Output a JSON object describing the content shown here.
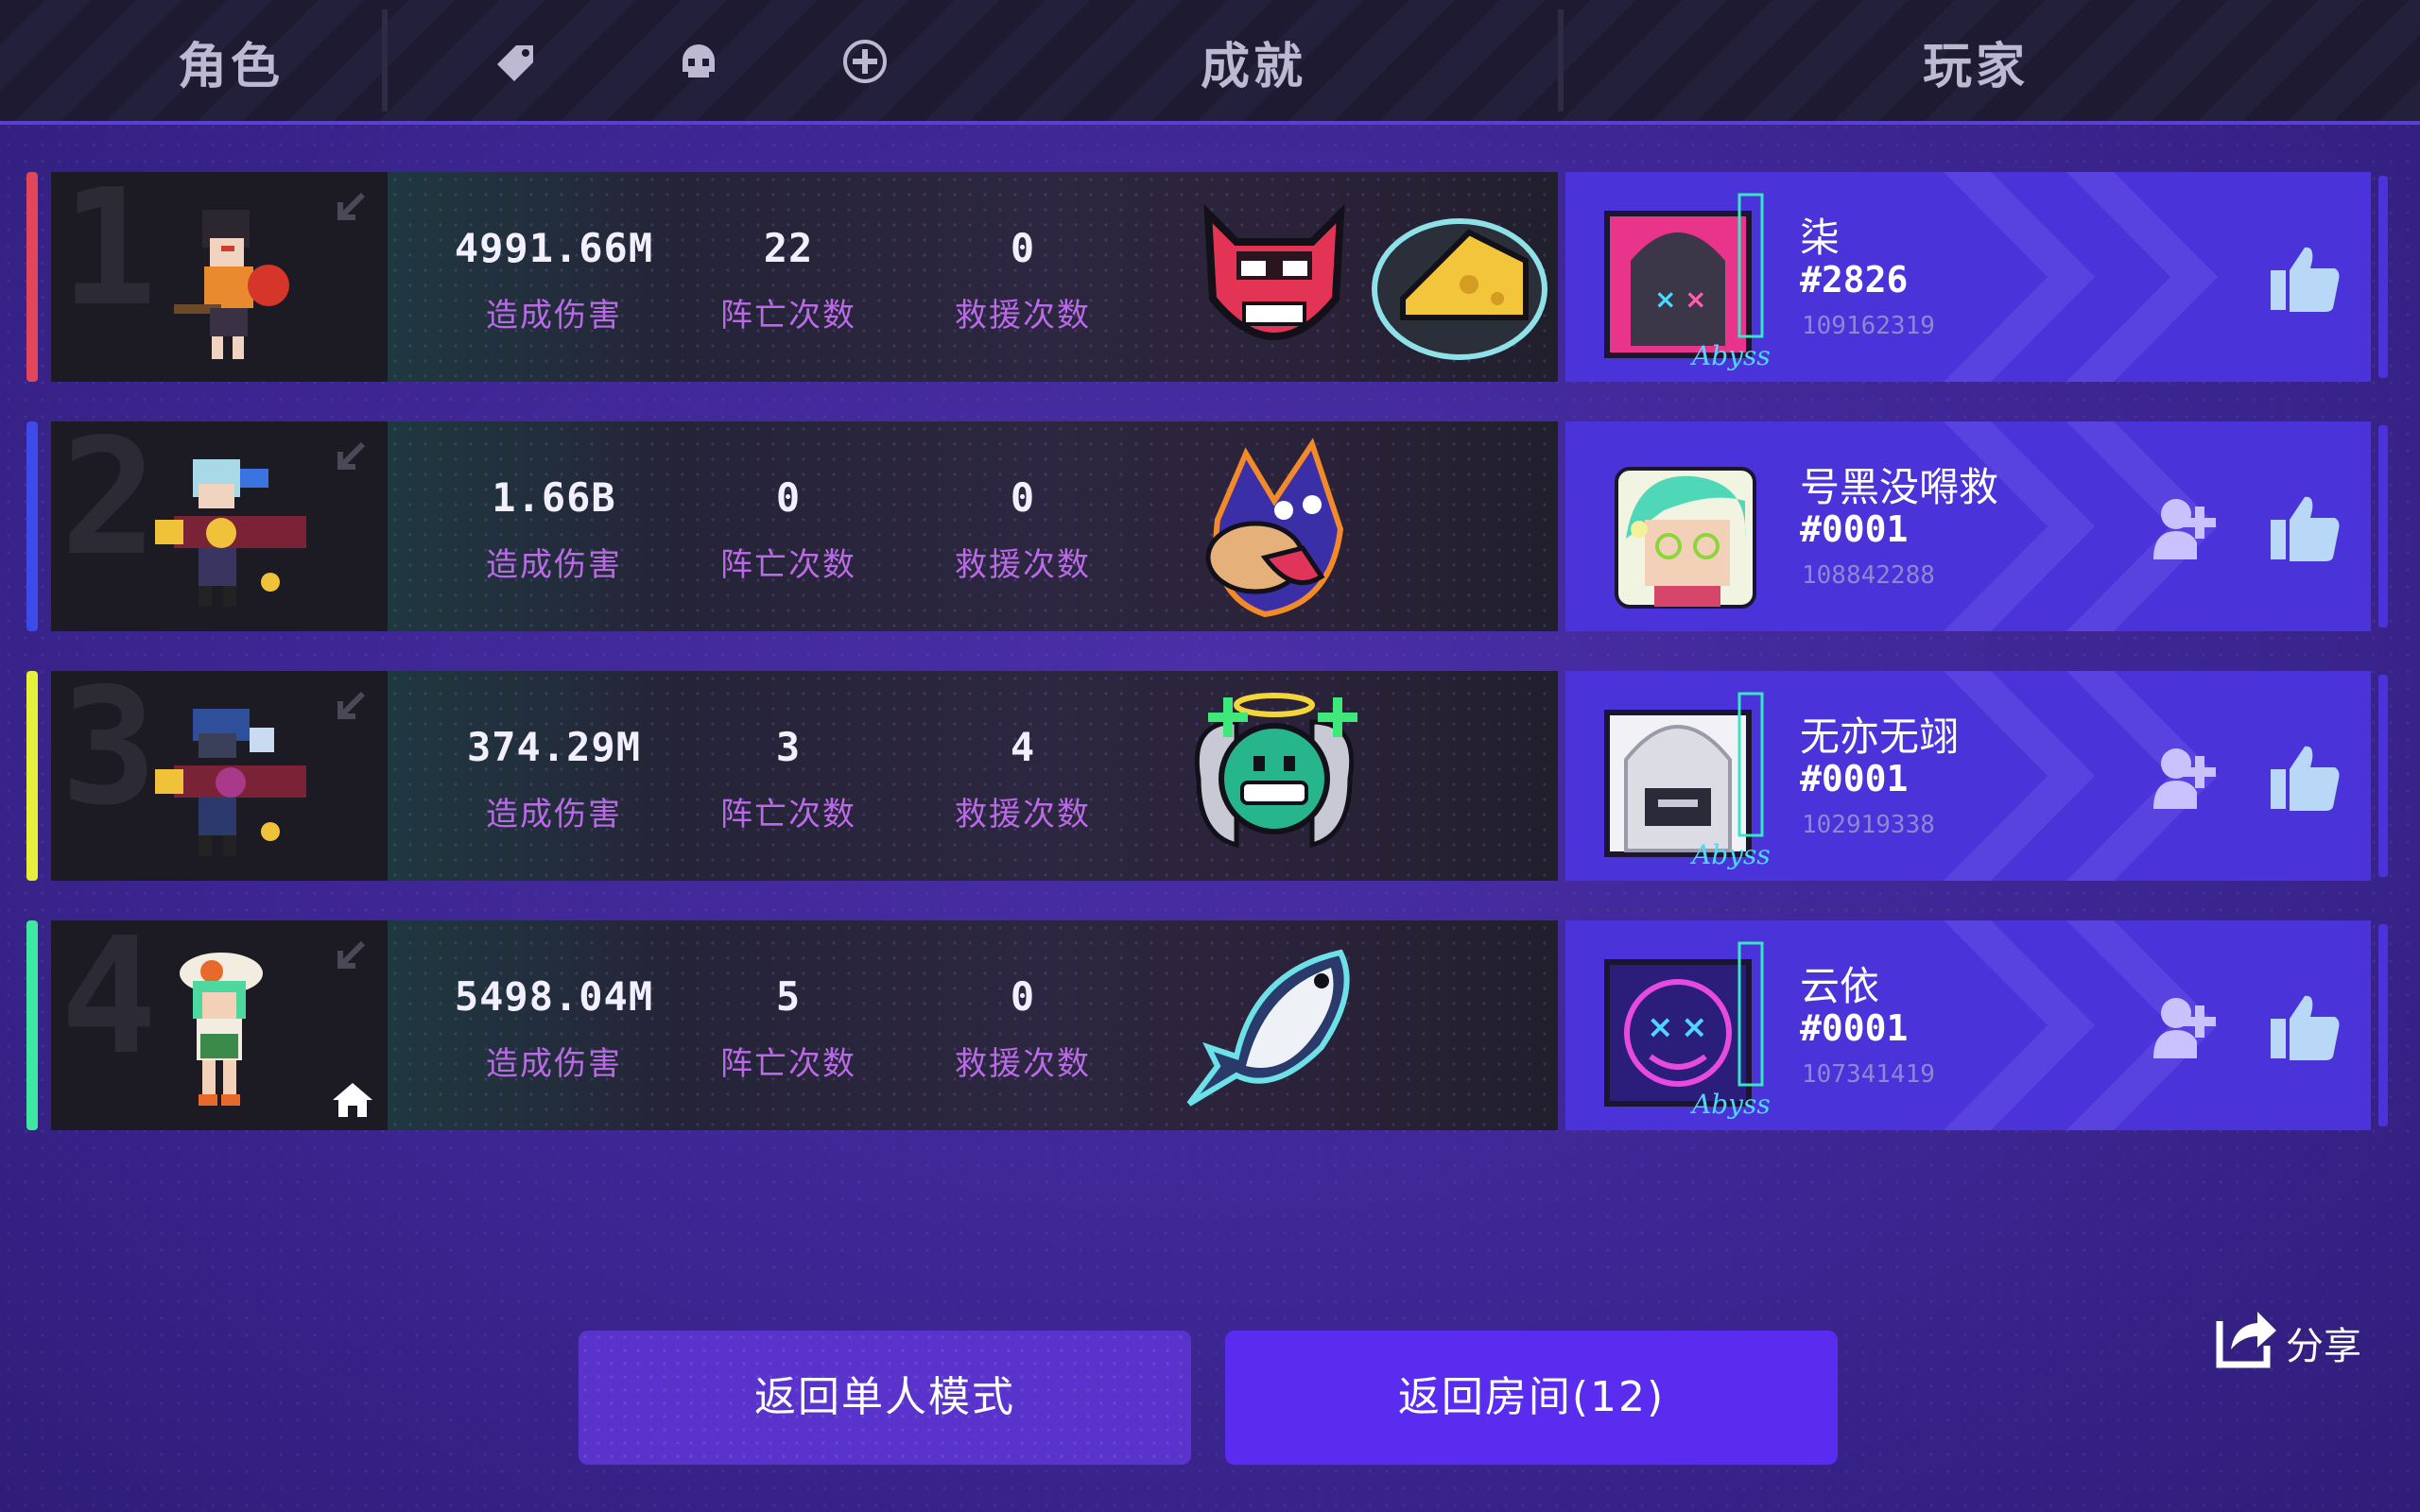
{
  "header": {
    "role_label": "角色",
    "achievement_label": "成就",
    "player_label": "玩家",
    "icons": [
      "tag-icon",
      "skull-icon",
      "heal-icon"
    ]
  },
  "rows": [
    {
      "rank": "1",
      "accent": "#e2465a",
      "damage_value": "4991.66M",
      "damage_label": "造成伤害",
      "deaths_value": "22",
      "deaths_label": "阵亡次数",
      "rescues_value": "0",
      "rescues_label": "救援次数",
      "badges": [
        "devil-mask-badge",
        "cheese-badge"
      ],
      "player": {
        "name": "柒",
        "tag": "#2826",
        "id": "109162319",
        "avatar": "neon-abyss-hood-avatar"
      },
      "is_host": false,
      "can_add_friend": false
    },
    {
      "rank": "2",
      "accent": "#3d4be8",
      "damage_value": "1.66B",
      "damage_label": "造成伤害",
      "deaths_value": "0",
      "deaths_label": "阵亡次数",
      "rescues_value": "0",
      "rescues_label": "救援次数",
      "badges": [
        "wolf-badge"
      ],
      "player": {
        "name": "号黑没嘚救",
        "tag": "#0001",
        "id": "108842288",
        "avatar": "green-hair-avatar"
      },
      "is_host": false,
      "can_add_friend": true
    },
    {
      "rank": "3",
      "accent": "#e6f03a",
      "damage_value": "374.29M",
      "damage_label": "造成伤害",
      "deaths_value": "3",
      "deaths_label": "阵亡次数",
      "rescues_value": "4",
      "rescues_label": "救援次数",
      "badges": [
        "angel-smile-badge"
      ],
      "player": {
        "name": "无亦无翊",
        "tag": "#0001",
        "id": "102919338",
        "avatar": "neon-abyss-white-hood-avatar"
      },
      "is_host": false,
      "can_add_friend": true
    },
    {
      "rank": "4",
      "accent": "#3ee8a0",
      "damage_value": "5498.04M",
      "damage_label": "造成伤害",
      "deaths_value": "5",
      "deaths_label": "阵亡次数",
      "rescues_value": "0",
      "rescues_label": "救援次数",
      "badges": [
        "fish-badge"
      ],
      "player": {
        "name": "云依",
        "tag": "#0001",
        "id": "107341419",
        "avatar": "neon-abyss-smiley-avatar"
      },
      "is_host": true,
      "can_add_friend": true
    }
  ],
  "buttons": {
    "single_mode": "返回单人模式",
    "room": "返回房间(12)"
  },
  "share_label": "分享",
  "colors": {
    "background": "#3d2693",
    "player_panel": "#4a33d8",
    "stat_label": "#b96be6",
    "room_button": "#5a2cf0"
  }
}
